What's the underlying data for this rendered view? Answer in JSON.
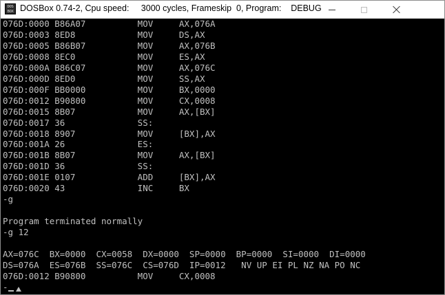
{
  "window": {
    "title": "DOSBox 0.74-2, Cpu speed:     3000 cycles, Frameskip  0, Program:    DEBUG",
    "icon_text": [
      "DOS",
      "BOX"
    ]
  },
  "console": {
    "lines": [
      "076D:0000 B86A07          MOV     AX,076A",
      "076D:0003 8ED8            MOV     DS,AX",
      "076D:0005 B86B07          MOV     AX,076B",
      "076D:0008 8EC0            MOV     ES,AX",
      "076D:000A B86C07          MOV     AX,076C",
      "076D:000D 8ED0            MOV     SS,AX",
      "076D:000F BB0000          MOV     BX,0000",
      "076D:0012 B90800          MOV     CX,0008",
      "076D:0015 8B07            MOV     AX,[BX]",
      "076D:0017 36              SS:",
      "076D:0018 8907            MOV     [BX],AX",
      "076D:001A 26              ES:",
      "076D:001B 8B07            MOV     AX,[BX]",
      "076D:001D 36              SS:",
      "076D:001E 0107            ADD     [BX],AX",
      "076D:0020 43              INC     BX",
      "-g",
      "",
      "Program terminated normally",
      "-g 12",
      "",
      "AX=076C  BX=0000  CX=0058  DX=0000  SP=0000  BP=0000  SI=0000  DI=0000",
      "DS=076A  ES=076B  SS=076C  CS=076D  IP=0012   NV UP EI PL NZ NA PO NC",
      "076D:0012 B90800          MOV     CX,0008"
    ],
    "prompt": "-"
  },
  "colors": {
    "console_bg": "#000000",
    "console_fg": "#c0c0c0",
    "titlebar_bg": "#ffffff"
  },
  "icons": {
    "minimize": "minimize-icon",
    "maximize": "maximize-icon",
    "close": "close-icon"
  }
}
